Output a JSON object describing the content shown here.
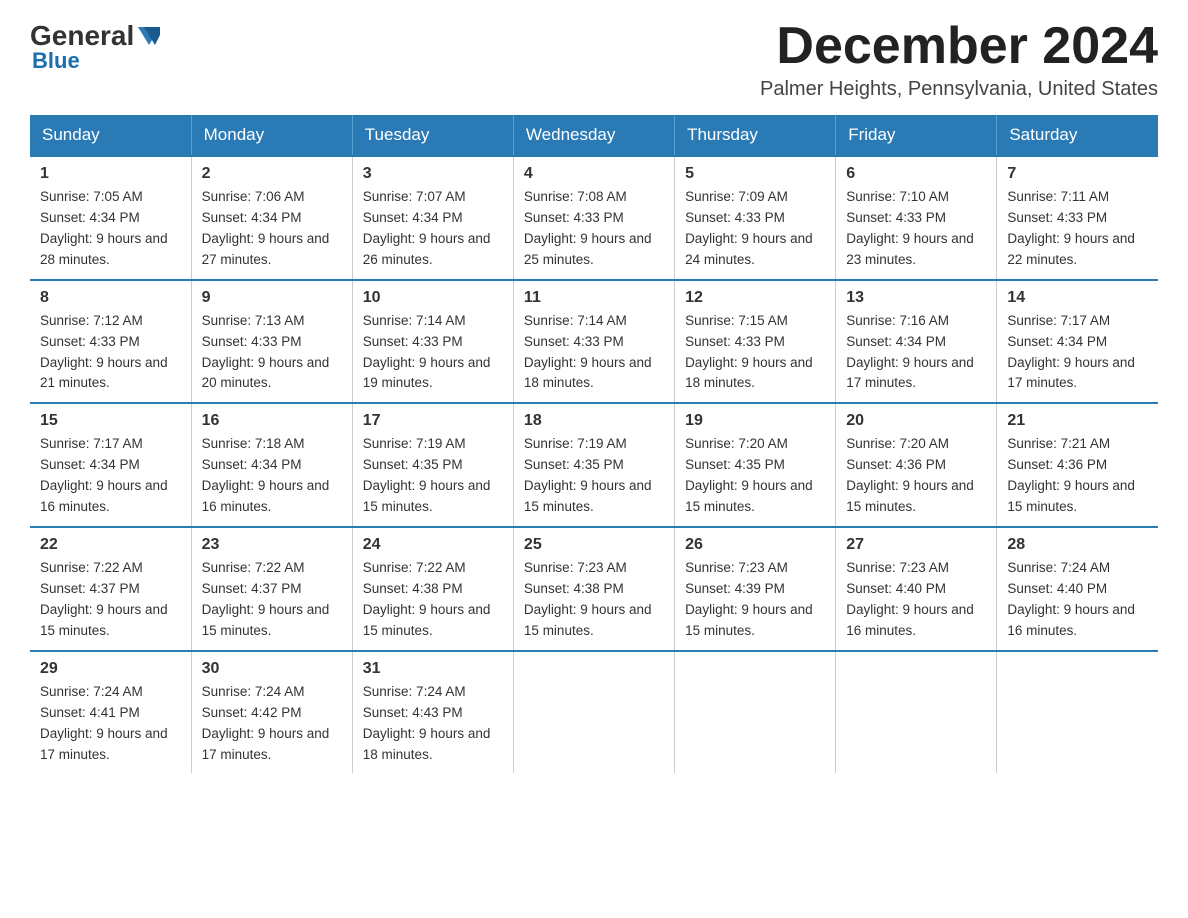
{
  "header": {
    "logo_general": "General",
    "logo_blue": "Blue",
    "month_title": "December 2024",
    "location": "Palmer Heights, Pennsylvania, United States"
  },
  "days_of_week": [
    "Sunday",
    "Monday",
    "Tuesday",
    "Wednesday",
    "Thursday",
    "Friday",
    "Saturday"
  ],
  "weeks": [
    [
      {
        "day": "1",
        "sunrise": "7:05 AM",
        "sunset": "4:34 PM",
        "daylight": "9 hours and 28 minutes."
      },
      {
        "day": "2",
        "sunrise": "7:06 AM",
        "sunset": "4:34 PM",
        "daylight": "9 hours and 27 minutes."
      },
      {
        "day": "3",
        "sunrise": "7:07 AM",
        "sunset": "4:34 PM",
        "daylight": "9 hours and 26 minutes."
      },
      {
        "day": "4",
        "sunrise": "7:08 AM",
        "sunset": "4:33 PM",
        "daylight": "9 hours and 25 minutes."
      },
      {
        "day": "5",
        "sunrise": "7:09 AM",
        "sunset": "4:33 PM",
        "daylight": "9 hours and 24 minutes."
      },
      {
        "day": "6",
        "sunrise": "7:10 AM",
        "sunset": "4:33 PM",
        "daylight": "9 hours and 23 minutes."
      },
      {
        "day": "7",
        "sunrise": "7:11 AM",
        "sunset": "4:33 PM",
        "daylight": "9 hours and 22 minutes."
      }
    ],
    [
      {
        "day": "8",
        "sunrise": "7:12 AM",
        "sunset": "4:33 PM",
        "daylight": "9 hours and 21 minutes."
      },
      {
        "day": "9",
        "sunrise": "7:13 AM",
        "sunset": "4:33 PM",
        "daylight": "9 hours and 20 minutes."
      },
      {
        "day": "10",
        "sunrise": "7:14 AM",
        "sunset": "4:33 PM",
        "daylight": "9 hours and 19 minutes."
      },
      {
        "day": "11",
        "sunrise": "7:14 AM",
        "sunset": "4:33 PM",
        "daylight": "9 hours and 18 minutes."
      },
      {
        "day": "12",
        "sunrise": "7:15 AM",
        "sunset": "4:33 PM",
        "daylight": "9 hours and 18 minutes."
      },
      {
        "day": "13",
        "sunrise": "7:16 AM",
        "sunset": "4:34 PM",
        "daylight": "9 hours and 17 minutes."
      },
      {
        "day": "14",
        "sunrise": "7:17 AM",
        "sunset": "4:34 PM",
        "daylight": "9 hours and 17 minutes."
      }
    ],
    [
      {
        "day": "15",
        "sunrise": "7:17 AM",
        "sunset": "4:34 PM",
        "daylight": "9 hours and 16 minutes."
      },
      {
        "day": "16",
        "sunrise": "7:18 AM",
        "sunset": "4:34 PM",
        "daylight": "9 hours and 16 minutes."
      },
      {
        "day": "17",
        "sunrise": "7:19 AM",
        "sunset": "4:35 PM",
        "daylight": "9 hours and 15 minutes."
      },
      {
        "day": "18",
        "sunrise": "7:19 AM",
        "sunset": "4:35 PM",
        "daylight": "9 hours and 15 minutes."
      },
      {
        "day": "19",
        "sunrise": "7:20 AM",
        "sunset": "4:35 PM",
        "daylight": "9 hours and 15 minutes."
      },
      {
        "day": "20",
        "sunrise": "7:20 AM",
        "sunset": "4:36 PM",
        "daylight": "9 hours and 15 minutes."
      },
      {
        "day": "21",
        "sunrise": "7:21 AM",
        "sunset": "4:36 PM",
        "daylight": "9 hours and 15 minutes."
      }
    ],
    [
      {
        "day": "22",
        "sunrise": "7:22 AM",
        "sunset": "4:37 PM",
        "daylight": "9 hours and 15 minutes."
      },
      {
        "day": "23",
        "sunrise": "7:22 AM",
        "sunset": "4:37 PM",
        "daylight": "9 hours and 15 minutes."
      },
      {
        "day": "24",
        "sunrise": "7:22 AM",
        "sunset": "4:38 PM",
        "daylight": "9 hours and 15 minutes."
      },
      {
        "day": "25",
        "sunrise": "7:23 AM",
        "sunset": "4:38 PM",
        "daylight": "9 hours and 15 minutes."
      },
      {
        "day": "26",
        "sunrise": "7:23 AM",
        "sunset": "4:39 PM",
        "daylight": "9 hours and 15 minutes."
      },
      {
        "day": "27",
        "sunrise": "7:23 AM",
        "sunset": "4:40 PM",
        "daylight": "9 hours and 16 minutes."
      },
      {
        "day": "28",
        "sunrise": "7:24 AM",
        "sunset": "4:40 PM",
        "daylight": "9 hours and 16 minutes."
      }
    ],
    [
      {
        "day": "29",
        "sunrise": "7:24 AM",
        "sunset": "4:41 PM",
        "daylight": "9 hours and 17 minutes."
      },
      {
        "day": "30",
        "sunrise": "7:24 AM",
        "sunset": "4:42 PM",
        "daylight": "9 hours and 17 minutes."
      },
      {
        "day": "31",
        "sunrise": "7:24 AM",
        "sunset": "4:43 PM",
        "daylight": "9 hours and 18 minutes."
      },
      null,
      null,
      null,
      null
    ]
  ]
}
